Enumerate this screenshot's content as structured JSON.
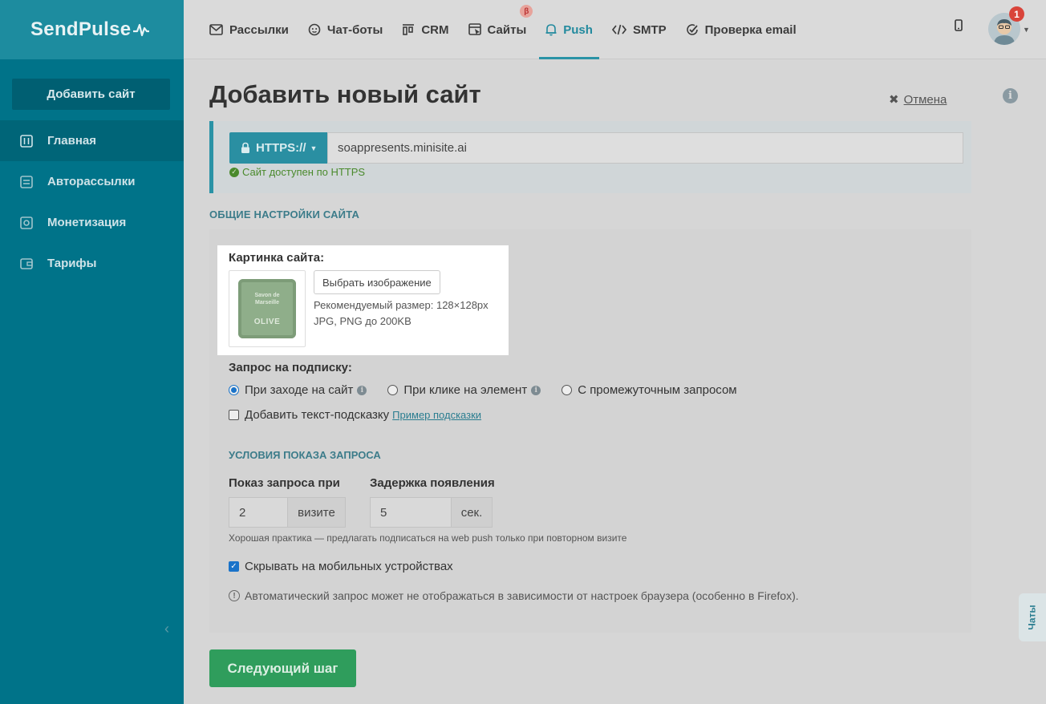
{
  "brand": {
    "name": "SendPulse"
  },
  "sidebar": {
    "add_site": "Добавить сайт",
    "items": [
      {
        "label": "Главная",
        "icon": "sliders-icon",
        "active": true
      },
      {
        "label": "Авторассылки",
        "icon": "automation-icon",
        "active": false
      },
      {
        "label": "Монетизация",
        "icon": "money-icon",
        "active": false
      },
      {
        "label": "Тарифы",
        "icon": "wallet-icon",
        "active": false
      }
    ]
  },
  "topnav": {
    "items": [
      {
        "label": "Рассылки",
        "icon": "envelope-icon"
      },
      {
        "label": "Чат-боты",
        "icon": "chatbot-icon"
      },
      {
        "label": "CRM",
        "icon": "crm-icon"
      },
      {
        "label": "Сайты",
        "icon": "site-builder-icon",
        "badge": "β"
      },
      {
        "label": "Push",
        "icon": "bell-icon",
        "active": true
      },
      {
        "label": "SMTP",
        "icon": "code-icon"
      },
      {
        "label": "Проверка email",
        "icon": "check-circle-icon"
      }
    ],
    "notifications": "1"
  },
  "page": {
    "title": "Добавить новый сайт",
    "cancel": "Отмена"
  },
  "url": {
    "protocol": "HTTPS://",
    "value": "soappresents.minisite.ai",
    "status": "Сайт доступен по HTTPS"
  },
  "general": {
    "section_title": "ОБЩИЕ НАСТРОЙКИ САЙТА",
    "image_label": "Картинка сайта:",
    "choose_image": "Выбрать изображение",
    "recommended": "Рекомендуемый размер: 128×128px",
    "formats": "JPG, PNG до 200KB",
    "image_text_top": "Savon de Marseille",
    "image_text_bottom": "OLIVE"
  },
  "subscription": {
    "label": "Запрос на подписку:",
    "options": [
      {
        "label": "При заходе на сайт",
        "selected": true,
        "info": true
      },
      {
        "label": "При клике на элемент",
        "selected": false,
        "info": true
      },
      {
        "label": "С промежуточным запросом",
        "selected": false,
        "info": false
      }
    ],
    "hint_checkbox": "Добавить текст-подсказку",
    "hint_link": "Пример подсказки"
  },
  "conditions": {
    "title": "УСЛОВИЯ ПОКАЗА ЗАПРОСА",
    "show_label": "Показ запроса при",
    "show_value": "2",
    "show_unit": "визите",
    "delay_label": "Задержка появления",
    "delay_value": "5",
    "delay_unit": "сек.",
    "practice": "Хорошая практика — предлагать подписаться на web push только при повторном визите",
    "hide_mobile": "Скрывать на мобильных устройствах",
    "hide_mobile_checked": true,
    "warning": "Автоматический запрос может не отображаться в зависимости от настроек браузера (особенно в Firefox)."
  },
  "footer": {
    "next": "Следующий шаг"
  },
  "chats": "Чаты"
}
